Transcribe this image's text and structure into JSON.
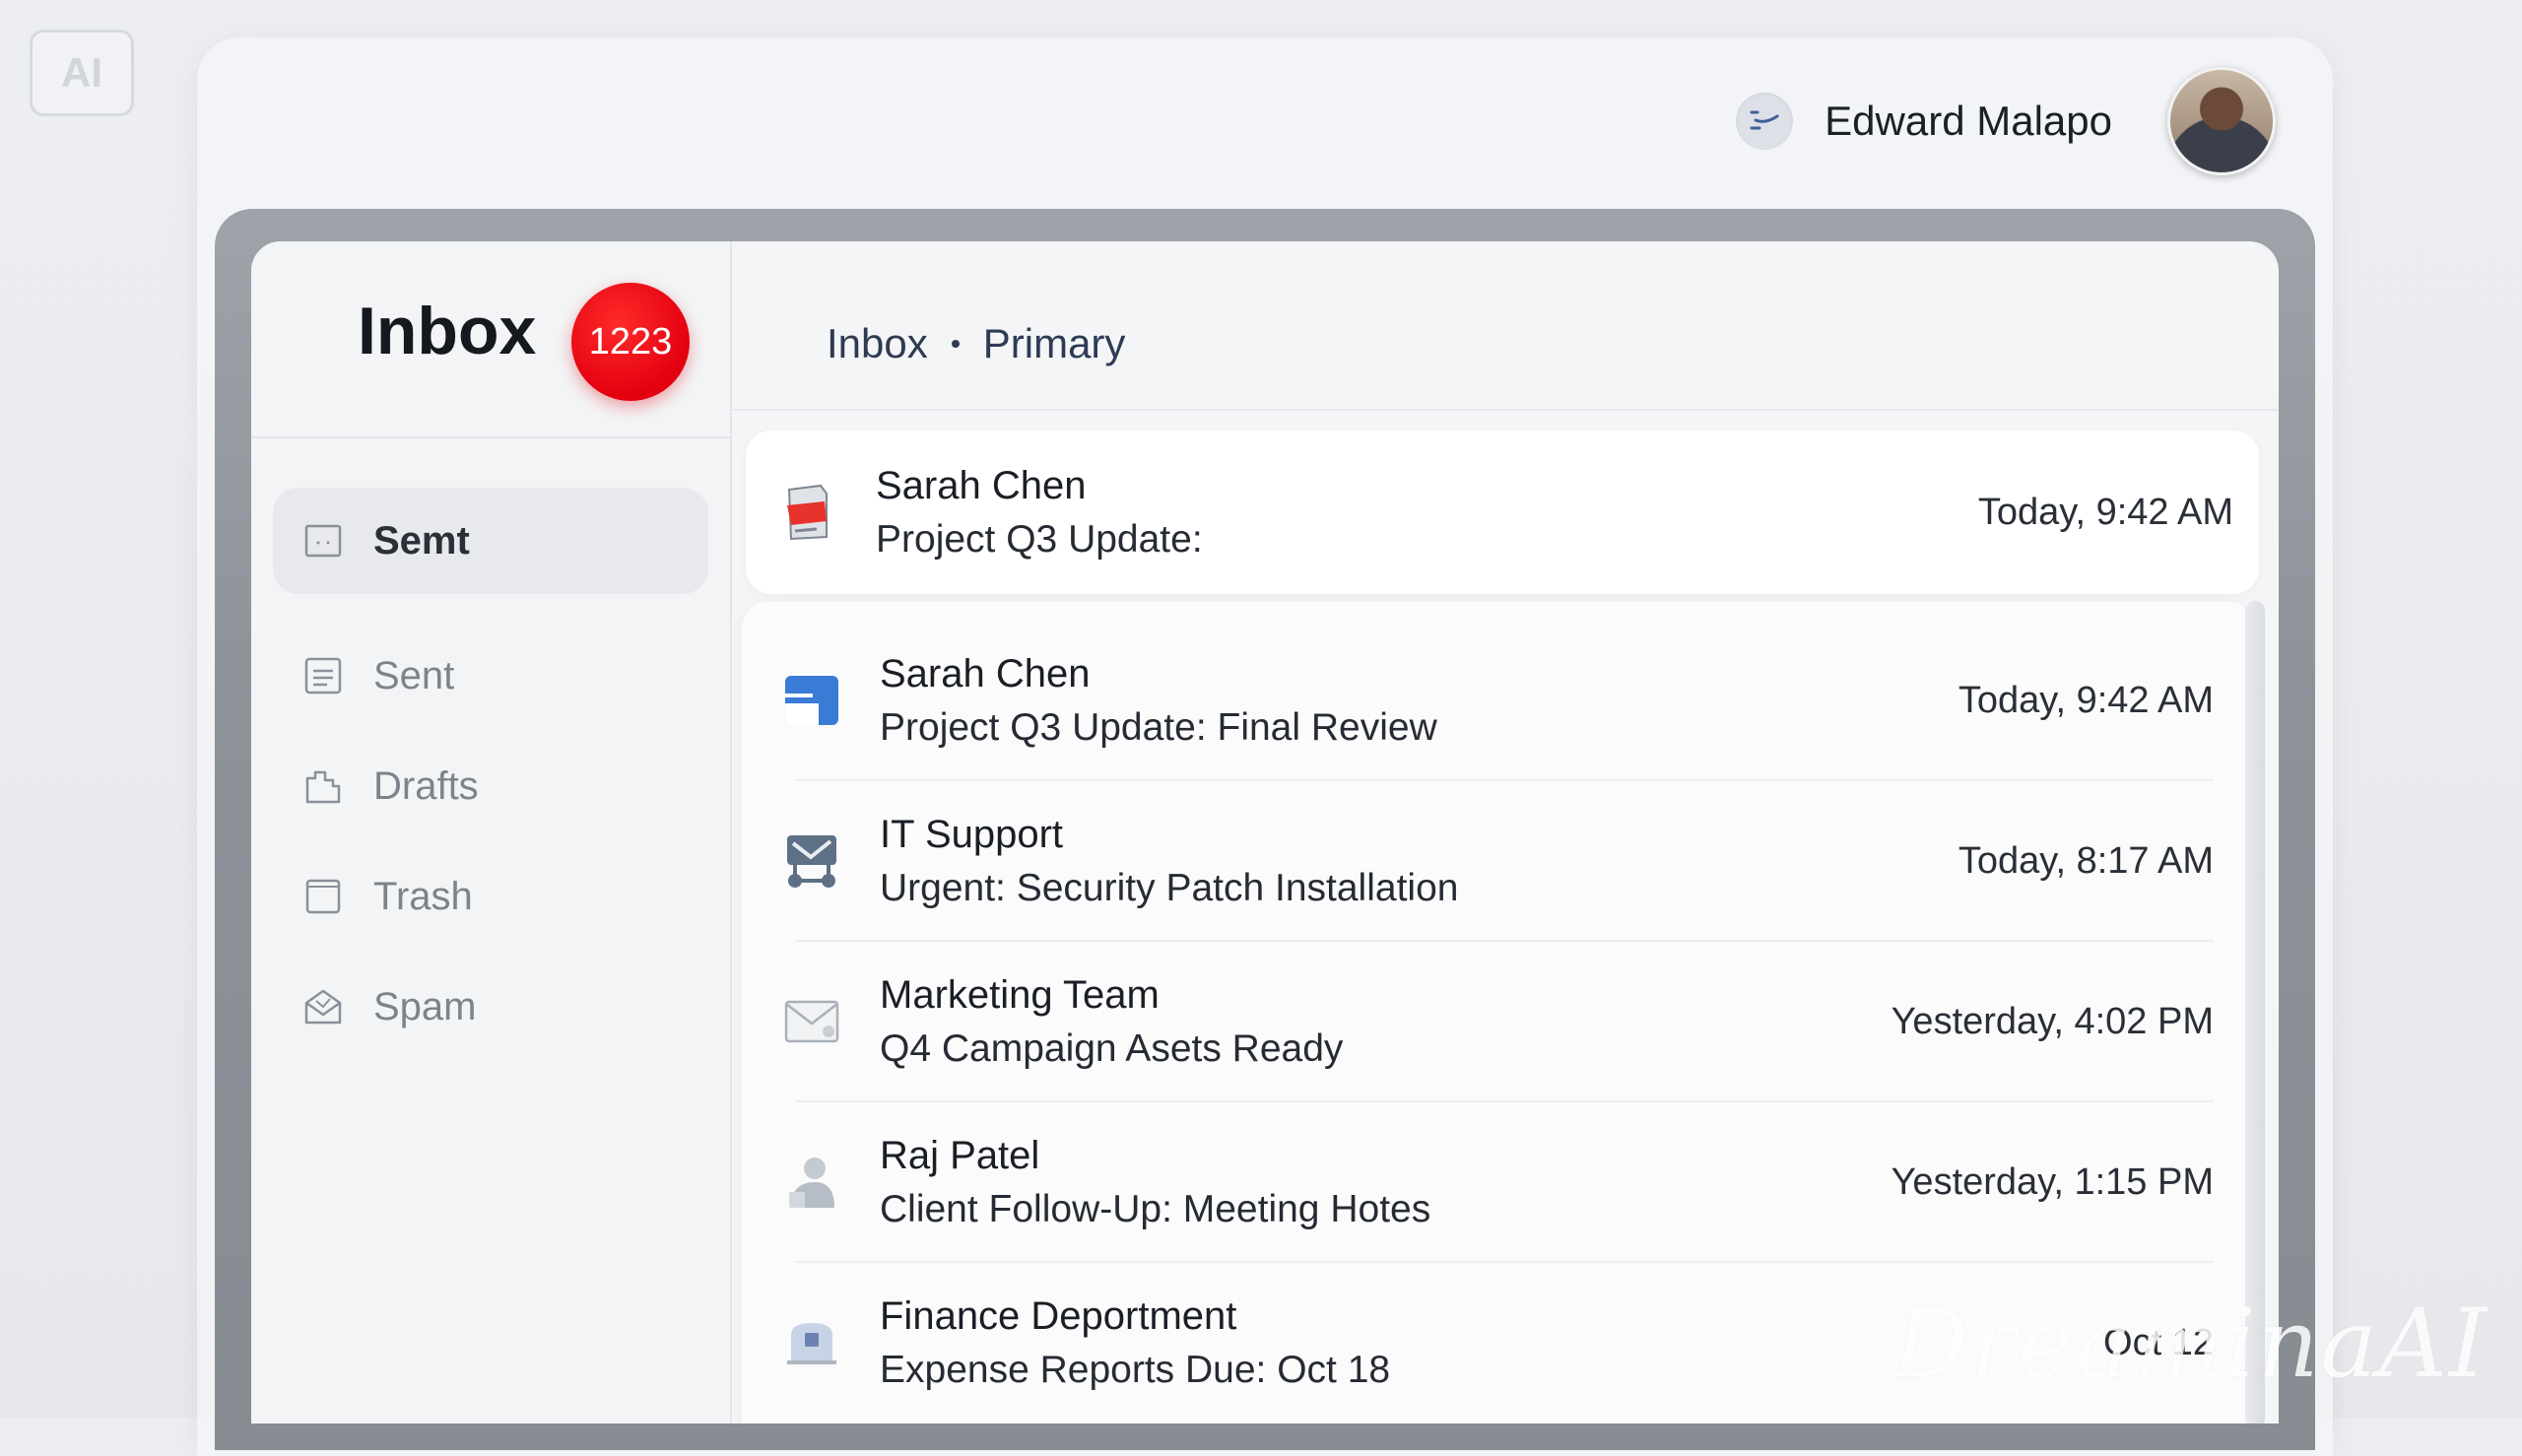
{
  "header": {
    "ai_badge": "AI",
    "user_name": "Edward Malapo"
  },
  "sidebar": {
    "title": "Inbox",
    "unread_count": "1223",
    "items": [
      {
        "label": "Semt",
        "icon": "inbox-tray-icon",
        "active": true
      },
      {
        "label": "Sent",
        "icon": "document-icon",
        "active": false
      },
      {
        "label": "Drafts",
        "icon": "drafts-icon",
        "active": false
      },
      {
        "label": "Trash",
        "icon": "trash-icon",
        "active": false
      },
      {
        "label": "Spam",
        "icon": "spam-envelope-icon",
        "active": false
      }
    ]
  },
  "main": {
    "breadcrumb": [
      "Inbox",
      "Primary"
    ],
    "pinned": {
      "sender": "Sarah Chen",
      "subject": "Project Q3 Update:",
      "time": "Today, 9:42 AM",
      "icon": "red-folder-icon"
    },
    "emails": [
      {
        "sender": "Sarah Chen",
        "subject": "Project Q3 Update: Final Review",
        "time": "Today, 9:42 AM",
        "icon": "blue-document-icon"
      },
      {
        "sender": "IT Support",
        "subject": "Urgent: Security Patch Installation",
        "time": "Today, 8:17 AM",
        "icon": "network-icon"
      },
      {
        "sender": "Marketing Team",
        "subject": "Q4 Campaign Asets Ready",
        "time": "Yesterday, 4:02 PM",
        "icon": "envelope-icon"
      },
      {
        "sender": "Raj Patel",
        "subject": "Client Follow-Up: Meeting Hotes",
        "time": "Yesterday, 1:15 PM",
        "icon": "person-icon"
      },
      {
        "sender": "Finance Deportment",
        "subject": "Expense Reports Due: Oct 18",
        "time": "Oct 12",
        "icon": "finance-icon"
      }
    ]
  },
  "watermark": "DreaminaAI",
  "colors": {
    "badge": "#e3000f",
    "accent_blue": "#3a7bd5"
  }
}
